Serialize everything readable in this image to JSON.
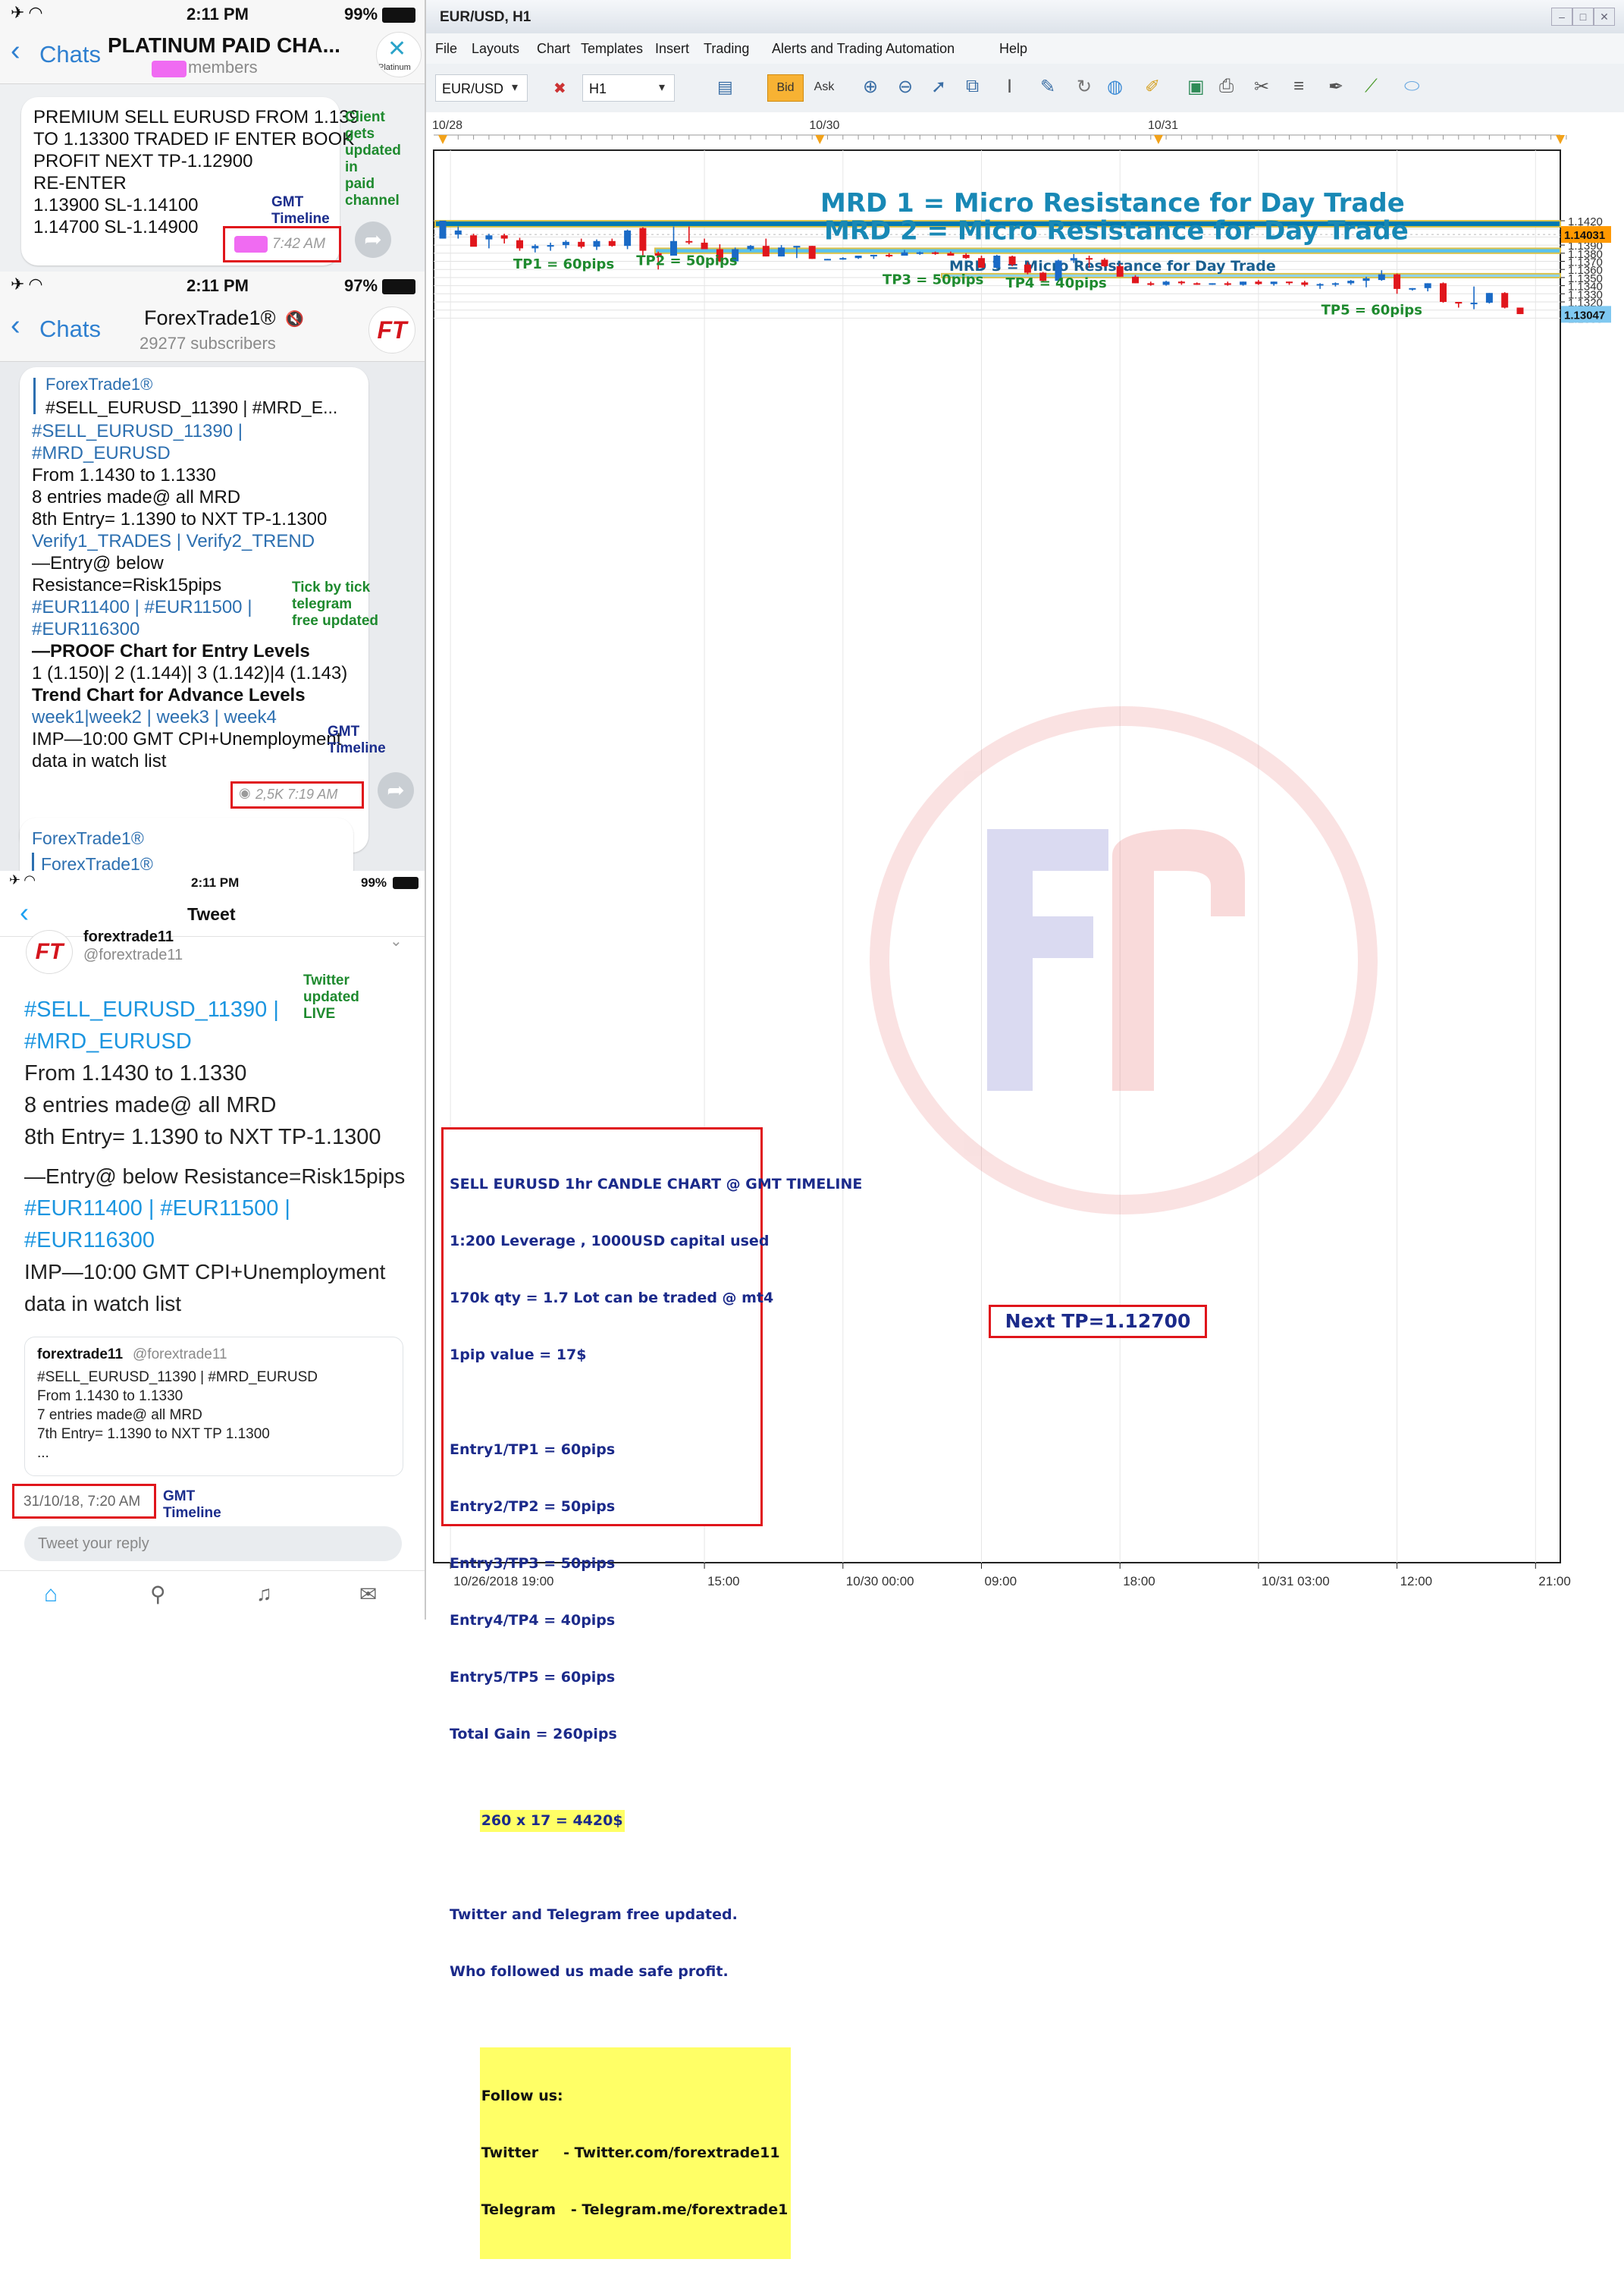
{
  "left": {
    "p1": {
      "time": "2:11 PM",
      "battery": "99%",
      "back_label": "Chats",
      "title": "PLATINUM PAID CHA...",
      "subtitle": "members",
      "avatar_text": "Platinum",
      "message_lines": [
        "PREMIUM SELL EURUSD FROM 1.139",
        "TO 1.13300 TRADED IF ENTER BOOK",
        "PROFIT NEXT TP-1.12900",
        "",
        "RE-ENTER",
        "1.13900 SL-1.14100",
        "1.14700 SL-1.14900"
      ],
      "msg_time": "7:42 AM",
      "note_client": "Client\ngets\nupdated\nin\npaid\nchannel",
      "note_gmt": "GMT\nTimeline"
    },
    "p2": {
      "time": "2:11 PM",
      "battery": "97%",
      "back_label": "Chats",
      "title": "ForexTrade1®",
      "subtitle": "29277 subscribers",
      "avatar_text": "FT",
      "reply_name": "ForexTrade1®",
      "reply_text": "#SELL_EURUSD_11390 | #MRD_E...",
      "lines": [
        "#SELL_EURUSD_11390 |",
        "#MRD_EURUSD",
        "From 1.1430 to 1.1330",
        "8 entries made@ all MRD",
        "8th Entry= 1.1390 to NXT TP-1.1300",
        "Verify1_TRADES | Verify2_TREND",
        "",
        "—Entry@ below",
        "Resistance=Risk15pips",
        "#EUR11400 | #EUR11500 |",
        "#EUR116300",
        "—PROOF Chart for Entry Levels",
        "1 (1.150)| 2 (1.144)| 3 (1.142)|4 (1.143)",
        "Trend Chart for Advance Levels",
        "week1|week2 | week3 | week4",
        "IMP—10:00 GMT CPI+Unemployment",
        "data in watch list"
      ],
      "views_time": "2,5K 7:19 AM",
      "note_tick": "Tick by tick\ntelegram\nfree updated",
      "note_gmt": "GMT\nTimeline",
      "next_name": "ForexTrade1®",
      "next_reply": "ForexTrade1®"
    },
    "p3": {
      "time": "2:11 PM",
      "battery": "99%",
      "title": "Tweet",
      "name": "forextrade11",
      "handle": "@forextrade11",
      "note_twitter": "Twitter\nupdated\nLIVE",
      "lines": [
        "#SELL_EURUSD_11390 |",
        "#MRD_EURUSD",
        "From 1.1430 to 1.1330",
        "8 entries made@ all MRD",
        "8th Entry= 1.1390 to NXT TP-1.1300",
        "—Entry@ below Resistance=Risk15pips",
        "#EUR11400 | #EUR11500 |",
        "#EUR116300",
        "IMP—10:00 GMT CPI+Unemployment",
        "data in watch list"
      ],
      "quote_name": "forextrade11",
      "quote_handle": "@forextrade11",
      "quote_lines": [
        "#SELL_EURUSD_11390 | #MRD_EURUSD",
        "From 1.1430 to 1.1330",
        "7 entries made@ all MRD",
        "7th Entry= 1.1390 to NXT TP 1.1300",
        "..."
      ],
      "date": "31/10/18, 7:20 AM",
      "note_gmt": "GMT\nTimeline",
      "reply_placeholder": "Tweet your reply"
    }
  },
  "window": {
    "title": "EUR/USD, H1",
    "menu": [
      "File",
      "Layouts",
      "Chart",
      "Templates",
      "Insert",
      "Trading",
      "Alerts and Trading Automation",
      "Help"
    ],
    "symbol": "EUR/USD",
    "timeframe": "H1",
    "bid": "Bid",
    "ask": "Ask"
  },
  "chart_data": {
    "type": "candlestick",
    "symbol": "EUR/USD",
    "timeframe": "H1",
    "ylim": [
      1.1295,
      1.1428
    ],
    "yticks": [
      1.142,
      1.141,
      1.14,
      1.139,
      1.138,
      1.137,
      1.136,
      1.135,
      1.134,
      1.133,
      1.132,
      1.131,
      1.13
    ],
    "ytick_labels": [
      "1.1420",
      "1.1410",
      "1.1400",
      "1.1390",
      "1.1380",
      "1.1370",
      "1.1360",
      "1.1350",
      "1.1340",
      "1.1330",
      "1.1320",
      "1.1310",
      "1.1300"
    ],
    "price_tags": [
      {
        "label": "1.14031",
        "value": 1.14031,
        "color": "#ff9900"
      },
      {
        "label": "1.13047",
        "value": 1.13047,
        "color": "#7fc8f0"
      }
    ],
    "top_dates": [
      {
        "label": "10/28",
        "bar": 0
      },
      {
        "label": "10/30",
        "bar": 24.5
      },
      {
        "label": "10/31",
        "bar": 46.5
      }
    ],
    "bottom_labels": [
      {
        "label": "10/26/2018 19:00",
        "bar": 0.5
      },
      {
        "label": "15:00",
        "bar": 17
      },
      {
        "label": "10/30 00:00",
        "bar": 26
      },
      {
        "label": "09:00",
        "bar": 35
      },
      {
        "label": "18:00",
        "bar": 44
      },
      {
        "label": "10/31 03:00",
        "bar": 53
      },
      {
        "label": "12:00",
        "bar": 62
      },
      {
        "label": "21:00",
        "bar": 71
      }
    ],
    "candles": [
      {
        "o": 1.1398,
        "h": 1.142,
        "l": 1.1398,
        "c": 1.142
      },
      {
        "o": 1.1403,
        "h": 1.1413,
        "l": 1.1398,
        "c": 1.1408
      },
      {
        "o": 1.1402,
        "h": 1.1404,
        "l": 1.1389,
        "c": 1.1388
      },
      {
        "o": 1.1397,
        "h": 1.1404,
        "l": 1.1386,
        "c": 1.1402
      },
      {
        "o": 1.1402,
        "h": 1.1404,
        "l": 1.1392,
        "c": 1.1398
      },
      {
        "o": 1.1396,
        "h": 1.1399,
        "l": 1.1383,
        "c": 1.1386
      },
      {
        "o": 1.1386,
        "h": 1.1391,
        "l": 1.1381,
        "c": 1.1389
      },
      {
        "o": 1.1389,
        "h": 1.1393,
        "l": 1.1383,
        "c": 1.139
      },
      {
        "o": 1.139,
        "h": 1.1396,
        "l": 1.1386,
        "c": 1.1394
      },
      {
        "o": 1.1394,
        "h": 1.1398,
        "l": 1.1386,
        "c": 1.1388
      },
      {
        "o": 1.1388,
        "h": 1.1397,
        "l": 1.1384,
        "c": 1.1395
      },
      {
        "o": 1.1395,
        "h": 1.1398,
        "l": 1.1388,
        "c": 1.1389
      },
      {
        "o": 1.1389,
        "h": 1.1409,
        "l": 1.1385,
        "c": 1.1408
      },
      {
        "o": 1.1411,
        "h": 1.1412,
        "l": 1.1376,
        "c": 1.1383
      },
      {
        "o": 1.138,
        "h": 1.1382,
        "l": 1.136,
        "c": 1.1377
      },
      {
        "o": 1.1377,
        "h": 1.1413,
        "l": 1.1377,
        "c": 1.1395
      },
      {
        "o": 1.1395,
        "h": 1.1413,
        "l": 1.1391,
        "c": 1.1394
      },
      {
        "o": 1.1393,
        "h": 1.1398,
        "l": 1.1386,
        "c": 1.1385
      },
      {
        "o": 1.1385,
        "h": 1.1391,
        "l": 1.1369,
        "c": 1.137
      },
      {
        "o": 1.137,
        "h": 1.1387,
        "l": 1.1366,
        "c": 1.1385
      },
      {
        "o": 1.1385,
        "h": 1.139,
        "l": 1.1383,
        "c": 1.1389
      },
      {
        "o": 1.1389,
        "h": 1.1398,
        "l": 1.1376,
        "c": 1.1376
      },
      {
        "o": 1.1376,
        "h": 1.139,
        "l": 1.1376,
        "c": 1.1387
      },
      {
        "o": 1.1387,
        "h": 1.1389,
        "l": 1.1374,
        "c": 1.1389
      },
      {
        "o": 1.1389,
        "h": 1.1389,
        "l": 1.1373,
        "c": 1.1373
      },
      {
        "o": 1.1373,
        "h": 1.1373,
        "l": 1.1372,
        "c": 1.1373
      },
      {
        "o": 1.1373,
        "h": 1.1375,
        "l": 1.1372,
        "c": 1.1374
      },
      {
        "o": 1.1374,
        "h": 1.1377,
        "l": 1.1373,
        "c": 1.1377
      },
      {
        "o": 1.1377,
        "h": 1.1378,
        "l": 1.1373,
        "c": 1.1378
      },
      {
        "o": 1.1378,
        "h": 1.138,
        "l": 1.1375,
        "c": 1.1377
      },
      {
        "o": 1.1377,
        "h": 1.1384,
        "l": 1.1377,
        "c": 1.1381
      },
      {
        "o": 1.1381,
        "h": 1.1382,
        "l": 1.1378,
        "c": 1.1381
      },
      {
        "o": 1.1381,
        "h": 1.1382,
        "l": 1.1378,
        "c": 1.138
      },
      {
        "o": 1.138,
        "h": 1.1382,
        "l": 1.1377,
        "c": 1.1377
      },
      {
        "o": 1.1378,
        "h": 1.138,
        "l": 1.1373,
        "c": 1.1374
      },
      {
        "o": 1.1374,
        "h": 1.1377,
        "l": 1.1362,
        "c": 1.1362
      },
      {
        "o": 1.1362,
        "h": 1.1378,
        "l": 1.1361,
        "c": 1.1377
      },
      {
        "o": 1.1376,
        "h": 1.1377,
        "l": 1.1364,
        "c": 1.1366
      },
      {
        "o": 1.1366,
        "h": 1.1369,
        "l": 1.1354,
        "c": 1.1356
      },
      {
        "o": 1.1356,
        "h": 1.1357,
        "l": 1.1345,
        "c": 1.1346
      },
      {
        "o": 1.1346,
        "h": 1.1372,
        "l": 1.1346,
        "c": 1.1371
      },
      {
        "o": 1.1371,
        "h": 1.1379,
        "l": 1.1368,
        "c": 1.1374
      },
      {
        "o": 1.1374,
        "h": 1.1377,
        "l": 1.1362,
        "c": 1.1373
      },
      {
        "o": 1.1372,
        "h": 1.1374,
        "l": 1.1363,
        "c": 1.1364
      },
      {
        "o": 1.1364,
        "h": 1.1367,
        "l": 1.1351,
        "c": 1.1351
      },
      {
        "o": 1.1351,
        "h": 1.1353,
        "l": 1.1343,
        "c": 1.1343
      },
      {
        "o": 1.1343,
        "h": 1.1345,
        "l": 1.134,
        "c": 1.1341
      },
      {
        "o": 1.1341,
        "h": 1.1346,
        "l": 1.134,
        "c": 1.1345
      },
      {
        "o": 1.1345,
        "h": 1.1346,
        "l": 1.1341,
        "c": 1.1343
      },
      {
        "o": 1.1343,
        "h": 1.1344,
        "l": 1.1341,
        "c": 1.1342
      },
      {
        "o": 1.1342,
        "h": 1.1343,
        "l": 1.1341,
        "c": 1.1343
      },
      {
        "o": 1.1343,
        "h": 1.1345,
        "l": 1.134,
        "c": 1.1341
      },
      {
        "o": 1.1341,
        "h": 1.1345,
        "l": 1.134,
        "c": 1.1345
      },
      {
        "o": 1.1345,
        "h": 1.1347,
        "l": 1.1341,
        "c": 1.1342
      },
      {
        "o": 1.1342,
        "h": 1.1345,
        "l": 1.134,
        "c": 1.1345
      },
      {
        "o": 1.1345,
        "h": 1.1345,
        "l": 1.1341,
        "c": 1.1344
      },
      {
        "o": 1.1344,
        "h": 1.1346,
        "l": 1.1339,
        "c": 1.1341
      },
      {
        "o": 1.1341,
        "h": 1.1343,
        "l": 1.1336,
        "c": 1.1342
      },
      {
        "o": 1.1342,
        "h": 1.1344,
        "l": 1.1339,
        "c": 1.1343
      },
      {
        "o": 1.1343,
        "h": 1.1347,
        "l": 1.1341,
        "c": 1.1346
      },
      {
        "o": 1.1346,
        "h": 1.1351,
        "l": 1.1338,
        "c": 1.1349
      },
      {
        "o": 1.1347,
        "h": 1.1359,
        "l": 1.1346,
        "c": 1.1354
      },
      {
        "o": 1.1354,
        "h": 1.1355,
        "l": 1.133,
        "c": 1.1336
      },
      {
        "o": 1.1336,
        "h": 1.1337,
        "l": 1.1334,
        "c": 1.1337
      },
      {
        "o": 1.1337,
        "h": 1.1343,
        "l": 1.1333,
        "c": 1.1343
      },
      {
        "o": 1.1343,
        "h": 1.1344,
        "l": 1.1319,
        "c": 1.132
      },
      {
        "o": 1.132,
        "h": 1.132,
        "l": 1.1313,
        "c": 1.1318
      },
      {
        "o": 1.1318,
        "h": 1.1339,
        "l": 1.1311,
        "c": 1.1319
      },
      {
        "o": 1.1319,
        "h": 1.1331,
        "l": 1.1318,
        "c": 1.1331
      },
      {
        "o": 1.1331,
        "h": 1.1332,
        "l": 1.1312,
        "c": 1.1313
      },
      {
        "o": 1.1313,
        "h": 1.1313,
        "l": 1.1305,
        "c": 1.1305
      }
    ],
    "zones": [
      {
        "label": "MRD 1 = Micro Resistance for Day Trade",
        "from": 1.14125,
        "to": 1.142,
        "color": "#0079b0"
      },
      {
        "label": "MRD 2 = Micro Resistance for Day Trade",
        "from": 1.138,
        "to": 1.1386,
        "color": "#59c2ef"
      },
      {
        "label": "MRD 3 = Micro Resistance for Day Trade",
        "from": 1.135,
        "to": 1.13547,
        "color": "#8fd4f3"
      }
    ],
    "tp_labels": [
      {
        "label": "TP1  = 60pips",
        "bar": 9.5,
        "value": 1.1361
      },
      {
        "label": "TP2  = 50pips",
        "bar": 17.5,
        "value": 1.13655
      },
      {
        "label": "TP3 = 50pips",
        "bar": 33.5,
        "value": 1.13418
      },
      {
        "label": "TP4 = 40pips",
        "bar": 41.5,
        "value": 1.13378
      },
      {
        "label": "TP5 = 60pips",
        "bar": 62,
        "value": 1.13048
      }
    ],
    "infobox": {
      "lines": [
        "SELL EURUSD 1hr CANDLE CHART @ GMT TIMELINE",
        "1:200 Leverage , 1000USD capital used",
        "170k qty = 1.7 Lot can be traded @ mt4",
        "1pip value = 17$",
        "",
        "Entry1/TP1 = 60pips",
        "Entry2/TP2 = 50pips",
        "Entry3/TP3 = 50pips",
        "Entry4/TP4 = 40pips",
        "Entry5/TP5 = 60pips",
        "Total Gain = 260pips"
      ],
      "calc": "260 x 17 = 4420$",
      "footer_lines": [
        "Twitter and Telegram free updated.",
        "Who followed us made safe profit."
      ],
      "follow": [
        "Follow us:",
        "Twitter     - Twitter.com/forextrade11",
        "Telegram   - Telegram.me/forextrade1"
      ]
    },
    "next_tp": "Next TP=1.12700",
    "watermark": "FT"
  }
}
